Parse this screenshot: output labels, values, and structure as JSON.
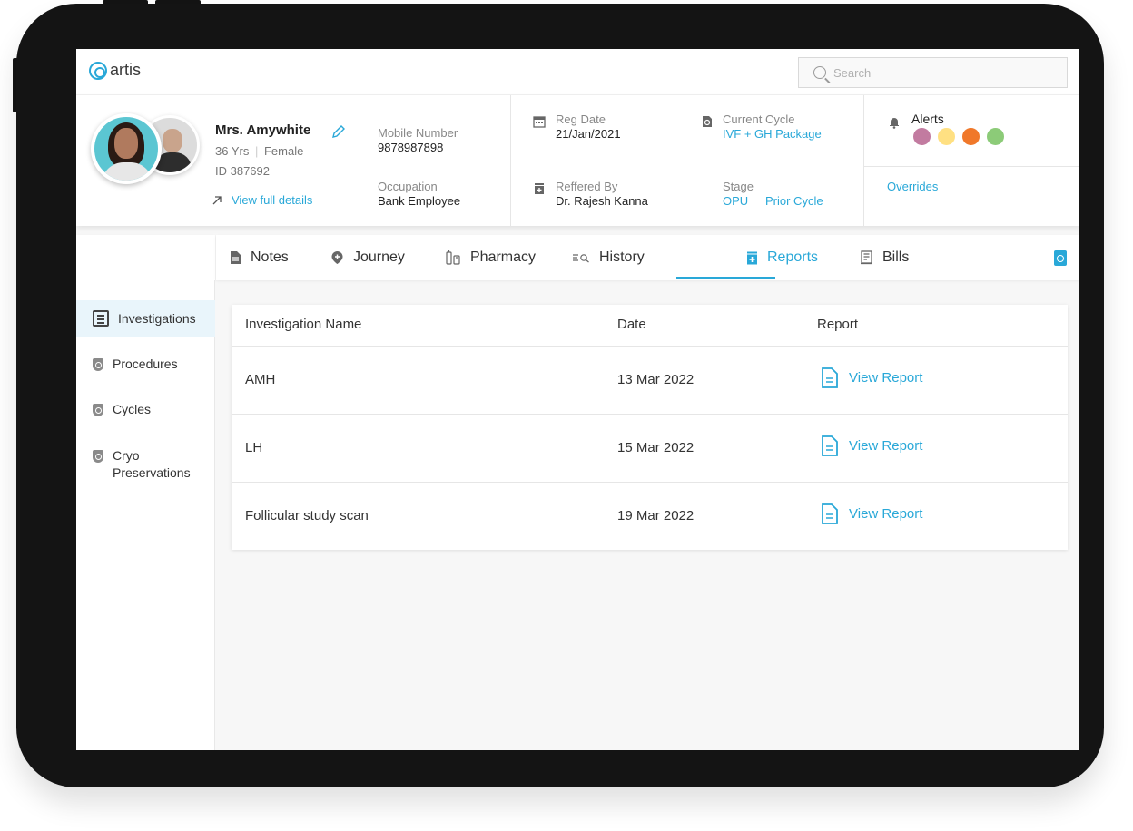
{
  "app": {
    "logo_text": "artis"
  },
  "search": {
    "placeholder": "Search"
  },
  "patient": {
    "name": "Mrs. Amywhite",
    "age": "36 Yrs",
    "separator": "|",
    "gender": "Female",
    "id": "ID 387692",
    "view_full_details": "View full details",
    "mobile_label": "Mobile Number",
    "mobile_value": "9878987898",
    "occupation_label": "Occupation",
    "occupation_value": "Bank Employee",
    "reg_date_label": "Reg Date",
    "reg_date_value": "21/Jan/2021",
    "referred_by_label": "Reffered By",
    "referred_by_value": "Dr. Rajesh Kanna",
    "current_cycle_label": "Current Cycle",
    "current_cycle_value": "IVF + GH Package",
    "stage_label": "Stage",
    "stage_value_1": "OPU",
    "stage_value_2": "Prior Cycle",
    "alerts_label": "Alerts",
    "alert_colors": [
      "#c27ba0",
      "#ffe082",
      "#f0782a",
      "#8ccb78"
    ],
    "overrides": "Overrides"
  },
  "tabs": [
    {
      "label": "Notes",
      "icon": "note-icon"
    },
    {
      "label": "Journey",
      "icon": "location-icon"
    },
    {
      "label": "Pharmacy",
      "icon": "medicine-icon"
    },
    {
      "label": "History",
      "icon": "history-icon"
    },
    {
      "label": "Reports",
      "icon": "report-icon",
      "active": true
    },
    {
      "label": "Bills",
      "icon": "bill-icon"
    }
  ],
  "sidebar": {
    "items": [
      {
        "label": "Investigations",
        "active": true
      },
      {
        "label": "Procedures"
      },
      {
        "label": "Cycles"
      },
      {
        "label": "Cryo\nPreservations"
      }
    ]
  },
  "table": {
    "headers": [
      "Investigation Name",
      "Date",
      "Report"
    ],
    "rows": [
      {
        "name": "AMH",
        "date": "13 Mar 2022",
        "report": "View Report"
      },
      {
        "name": "LH",
        "date": "15 Mar 2022",
        "report": "View Report"
      },
      {
        "name": "Follicular study scan",
        "date": "19 Mar 2022",
        "report": "View Report"
      }
    ]
  }
}
